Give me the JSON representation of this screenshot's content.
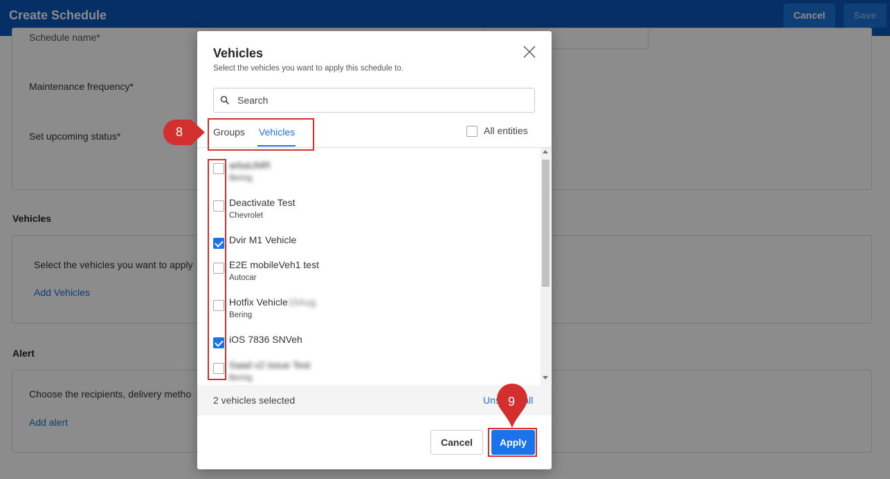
{
  "app": {
    "title": "Create Schedule",
    "cancel_label": "Cancel",
    "save_label": "Save"
  },
  "form": {
    "schedule_name_label": "Schedule name*",
    "maintenance_frequency_label": "Maintenance frequency*",
    "upcoming_status_label": "Set upcoming status*",
    "vehicles_section_title": "Vehicles",
    "vehicles_hint": "Select the vehicles you want to apply",
    "add_vehicles_label": "Add Vehicles",
    "alert_section_title": "Alert",
    "alert_hint": "Choose the recipients, delivery metho",
    "add_alert_label": "Add alert"
  },
  "modal": {
    "title": "Vehicles",
    "subtitle": "Select the vehicles you want to apply this schedule to.",
    "search_placeholder": "Search",
    "tabs": [
      {
        "label": "Groups",
        "active": false
      },
      {
        "label": "Vehicles",
        "active": true
      }
    ],
    "all_entities_label": "All entities",
    "vehicles": [
      {
        "name": "arbaUMR",
        "make": "Bering",
        "checked": false,
        "blurred": true
      },
      {
        "name": "Deactivate Test",
        "make": "Chevrolet",
        "checked": false,
        "blurred": false
      },
      {
        "name": "Dvir M1 Vehicle",
        "make": "",
        "checked": true,
        "blurred": false
      },
      {
        "name": "E2E mobileVeh1 test",
        "make": "Autocar",
        "checked": false,
        "blurred": false
      },
      {
        "name": "Hotfix Vehicle",
        "name_suffix": "15Aug",
        "make": "Bering",
        "checked": false,
        "blurred": false
      },
      {
        "name": "iOS 7836 SNVeh",
        "make": "",
        "checked": true,
        "blurred": false
      },
      {
        "name": "Saad v2 issue Test",
        "make": "Bering",
        "checked": false,
        "blurred": true
      }
    ],
    "selected_count_text": "2 vehicles selected",
    "unselect_all_label": "Unselect all",
    "cancel_label": "Cancel",
    "apply_label": "Apply"
  },
  "annotations": {
    "step_8": "8",
    "step_9": "9",
    "color": "#d32f2f"
  },
  "colors": {
    "header": "#0b56b8",
    "accent": "#1a73e8"
  }
}
